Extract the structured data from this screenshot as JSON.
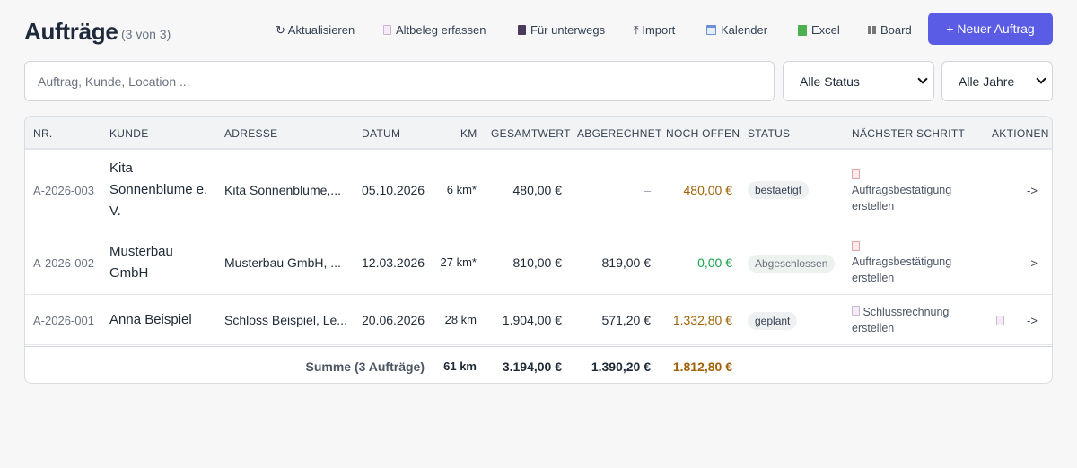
{
  "header": {
    "title": "Aufträge",
    "count": "(3 von 3)"
  },
  "toolbar": {
    "refresh": "↻ Aktualisieren",
    "altbeleg": "Altbeleg erfassen",
    "unterwegs": "Für unterwegs",
    "import": "⤒ Import",
    "kalender": "Kalender",
    "excel": "Excel",
    "board": "Board",
    "new_order": "+ Neuer Auftrag"
  },
  "filters": {
    "search_placeholder": "Auftrag, Kunde, Location ...",
    "status_value": "Alle Status",
    "year_value": "Alle Jahre"
  },
  "table": {
    "columns": [
      "NR.",
      "KUNDE",
      "ADRESSE",
      "DATUM",
      "KM",
      "GESAMTWERT",
      "ABGERECHNET",
      "NOCH OFFEN",
      "STATUS",
      "NÄCHSTER SCHRITT",
      "AKTIONEN"
    ],
    "rows": [
      {
        "nr": "A-2026-003",
        "kunde": "Kita Sonnenblume e. V.",
        "adresse": "Kita Sonnenblume,...",
        "datum": "05.10.2026",
        "km": "6 km*",
        "gesamt": "480,00 €",
        "abgerechnet": "–",
        "offen": "480,00 €",
        "status": "bestaetigt",
        "naechster": "Auftragsbestätigung erstellen",
        "aktion": "->"
      },
      {
        "nr": "A-2026-002",
        "kunde": "Musterbau GmbH",
        "adresse": "Musterbau GmbH, ...",
        "datum": "12.03.2026",
        "km": "27 km*",
        "gesamt": "810,00 €",
        "abgerechnet": "819,00 €",
        "offen": "0,00 €",
        "status": "Abgeschlossen",
        "naechster": "Auftragsbestätigung erstellen",
        "aktion": "->"
      },
      {
        "nr": "A-2026-001",
        "kunde": "Anna Beispiel",
        "adresse": "Schloss Beispiel, Le...",
        "datum": "20.06.2026",
        "km": "28 km",
        "gesamt": "1.904,00 €",
        "abgerechnet": "571,20 €",
        "offen": "1.332,80 €",
        "status": "geplant",
        "naechster": "Schlussrechnung erstellen",
        "aktion": "->"
      }
    ],
    "sum": {
      "label": "Summe (3 Aufträge)",
      "km": "61 km",
      "gesamt": "3.194,00 €",
      "abgerechnet": "1.390,20 €",
      "offen": "1.812,80 €"
    }
  },
  "colors": {
    "accent": "#5b5ce6",
    "open_amount": "#a16207",
    "zero_amount": "#16a34a"
  }
}
